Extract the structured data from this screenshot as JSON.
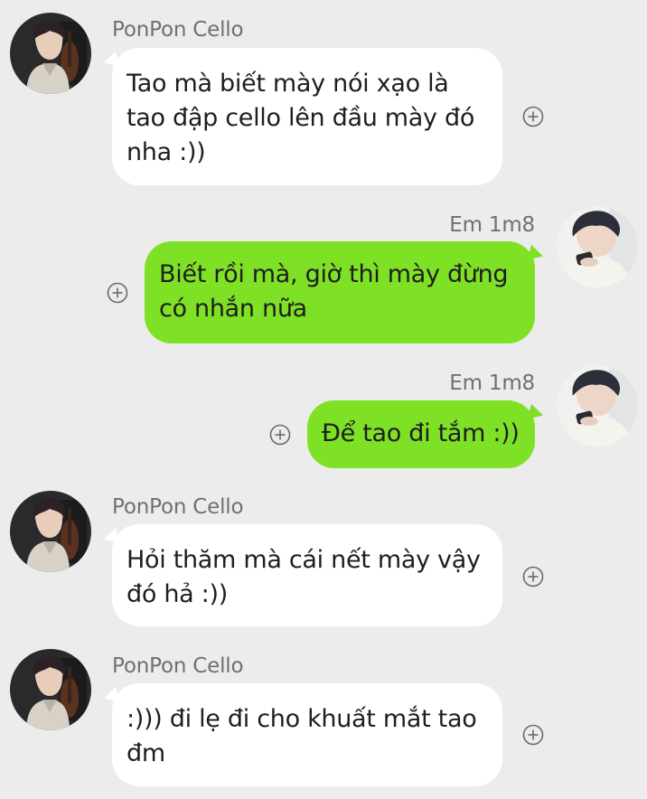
{
  "chat": {
    "messages": [
      {
        "direction": "incoming",
        "sender": "PonPon Cello",
        "lines": [
          "Tao mà biết mày nói xạo là",
          "tao đập cello lên đầu mày đó",
          "nha :))"
        ],
        "reaction_icon": "add-reaction-icon"
      },
      {
        "direction": "outgoing",
        "sender": "Em 1m8",
        "lines": [
          "Biết rồi mà, giờ thì mày đừng",
          "có nhắn nữa"
        ],
        "reaction_icon": "add-reaction-icon"
      },
      {
        "direction": "outgoing",
        "sender": "Em 1m8",
        "lines": [
          "Để tao đi tắm :))"
        ],
        "reaction_icon": "add-reaction-icon"
      },
      {
        "direction": "incoming",
        "sender": "PonPon Cello",
        "lines": [
          "Hỏi thăm mà cái nết mày vậy",
          "đó hả :))"
        ],
        "reaction_icon": "add-reaction-icon"
      },
      {
        "direction": "incoming",
        "sender": "PonPon Cello",
        "lines": [
          ":))) đi lẹ đi cho khuất mắt tao",
          "đm"
        ],
        "reaction_icon": "add-reaction-icon"
      }
    ]
  },
  "colors": {
    "background": "#ececec",
    "incoming_bubble": "#ffffff",
    "outgoing_bubble": "#7fe125",
    "sender_text": "#707070",
    "message_text": "#1e1e1e"
  }
}
